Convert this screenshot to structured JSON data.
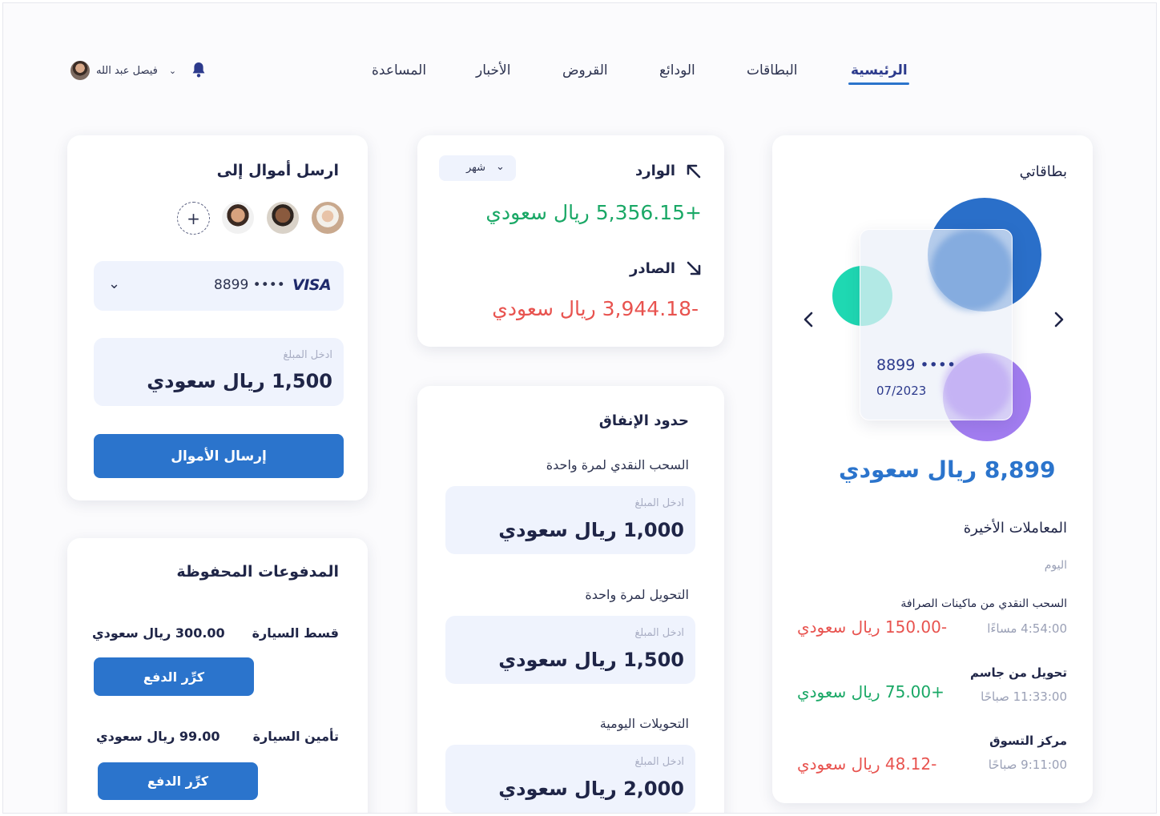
{
  "user": {
    "name": "فيصل عبد الله"
  },
  "nav": {
    "items": [
      "الرئيسية",
      "البطاقات",
      "الودائع",
      "القروض",
      "الأخبار",
      "المساعدة"
    ],
    "active": "الرئيسية"
  },
  "send": {
    "title": "ارسل أموال إلى",
    "card_brand": "VISA",
    "card_masked": "8899 ••••",
    "amount_hint": "ادخل المبلغ",
    "amount": "1,500 ريال سعودي",
    "button": "إرسال الأموال"
  },
  "cashflow": {
    "period": "شهر",
    "income_label": "الوارد",
    "income_value": "+5,356.15 ريال سعودي",
    "outgoing_label": "الصادر",
    "outgoing_value": "-3,944.18 ريال سعودي"
  },
  "limits": {
    "title": "حدود الإنفاق",
    "hint": "ادخل المبلغ",
    "items": [
      {
        "label": "السحب النقدي لمرة واحدة",
        "value": "1,000 ريال سعودي"
      },
      {
        "label": "التحويل لمرة واحدة",
        "value": "1,500 ريال سعودي"
      },
      {
        "label": "التحويلات اليومية",
        "value": "2,000 ريال سعودي"
      }
    ]
  },
  "saved": {
    "title": "المدفوعات المحفوظة",
    "items": [
      {
        "name": "قسط السيارة",
        "amount": "300.00 ريال سعودي",
        "button": "كرِّر الدفع"
      },
      {
        "name": "تأمين السيارة",
        "amount": "99.00 ريال سعودي",
        "button": "كرِّر الدفع"
      }
    ]
  },
  "mycards": {
    "title": "بطاقاتي",
    "card_masked": "8899 ••••",
    "card_expiry": "07/2023",
    "balance": "8,899 ريال سعودي",
    "colors": {
      "blue": "#2a6fc9",
      "teal": "#1fd8b2",
      "purple": "#a27df0"
    }
  },
  "transactions": {
    "title": "المعاملات الأخيرة",
    "group": "اليوم",
    "items": [
      {
        "name": "السحب النقدي من ماكينات الصرافة",
        "time": "4:54:00 مساءًا",
        "amount": "-150.00 ريال سعودي",
        "type": "debit"
      },
      {
        "name": "تحويل من جاسم",
        "time": "11:33:00 صباحًا",
        "amount": "+75.00 ريال سعودي",
        "type": "credit"
      },
      {
        "name": "مركز التسوق",
        "time": "9:11:00 صباحًا",
        "amount": "-48.12 ريال سعودي",
        "type": "debit"
      }
    ]
  }
}
